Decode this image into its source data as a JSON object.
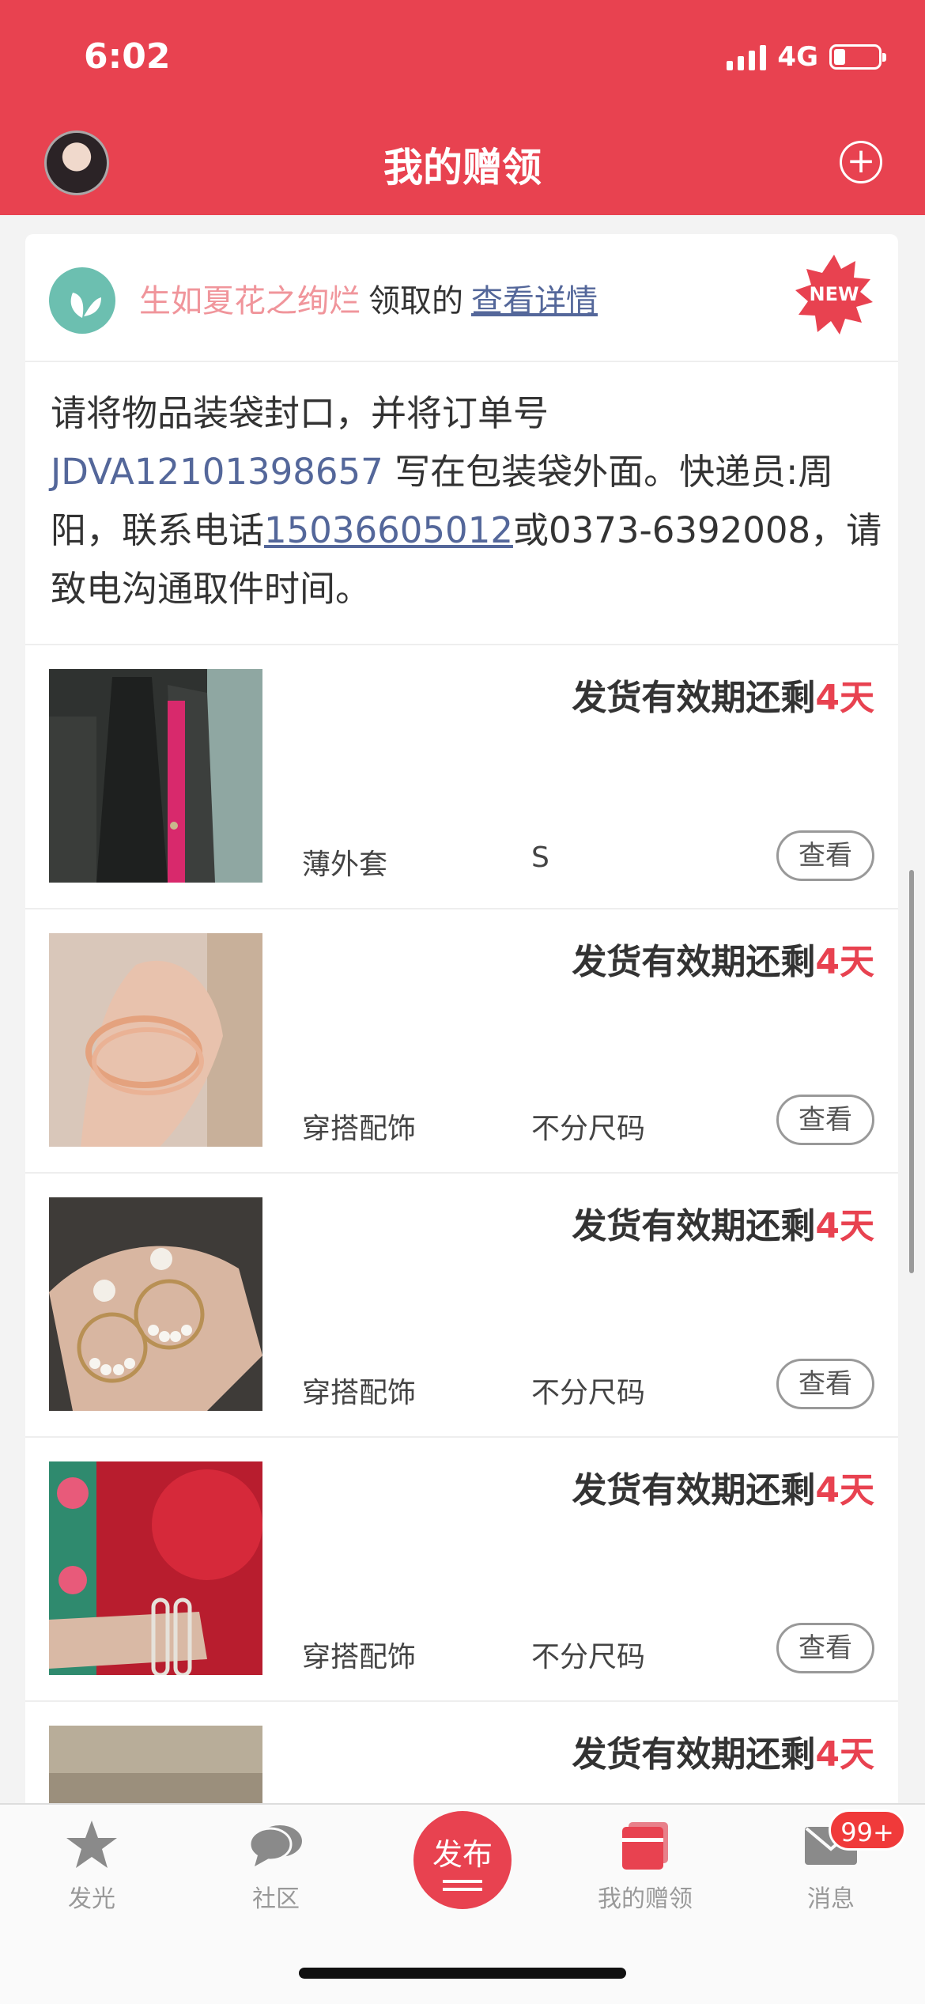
{
  "status": {
    "time": "6:02",
    "network": "4G"
  },
  "header": {
    "title": "我的赠领",
    "add_icon": "plus-circle-icon"
  },
  "notice": {
    "user": "生如夏花之绚烂",
    "action": "领取的",
    "link": "查看详情",
    "badge": "NEW",
    "instr_pre": "请将物品装袋封口，并将订单号 ",
    "order_no": "JDVA12101398657",
    "instr_mid": " 写在包装袋外面。快递员:周阳，联系电话",
    "phone": "15036605012",
    "instr_post": "或0373-6392008，请致电沟通取件时间。"
  },
  "items": [
    {
      "deadline_prefix": "发货有效期还剩",
      "days": "4天",
      "category": "薄外套",
      "size": "S",
      "button": "查看"
    },
    {
      "deadline_prefix": "发货有效期还剩",
      "days": "4天",
      "category": "穿搭配饰",
      "size": "不分尺码",
      "button": "查看"
    },
    {
      "deadline_prefix": "发货有效期还剩",
      "days": "4天",
      "category": "穿搭配饰",
      "size": "不分尺码",
      "button": "查看"
    },
    {
      "deadline_prefix": "发货有效期还剩",
      "days": "4天",
      "category": "穿搭配饰",
      "size": "不分尺码",
      "button": "查看"
    },
    {
      "deadline_prefix": "发货有效期还剩",
      "days": "4天"
    }
  ],
  "tabbar": {
    "tabs": [
      {
        "label": "发光",
        "icon": "star-icon"
      },
      {
        "label": "社区",
        "icon": "chat-bubbles-icon"
      },
      {
        "label": "发布",
        "icon": "publish-icon"
      },
      {
        "label": "我的赠领",
        "icon": "gift-box-icon"
      },
      {
        "label": "消息",
        "icon": "envelope-icon"
      }
    ],
    "badge": "99+"
  },
  "colors": {
    "brand": "#e84250",
    "link": "#54679a",
    "user": "#f0959b"
  }
}
